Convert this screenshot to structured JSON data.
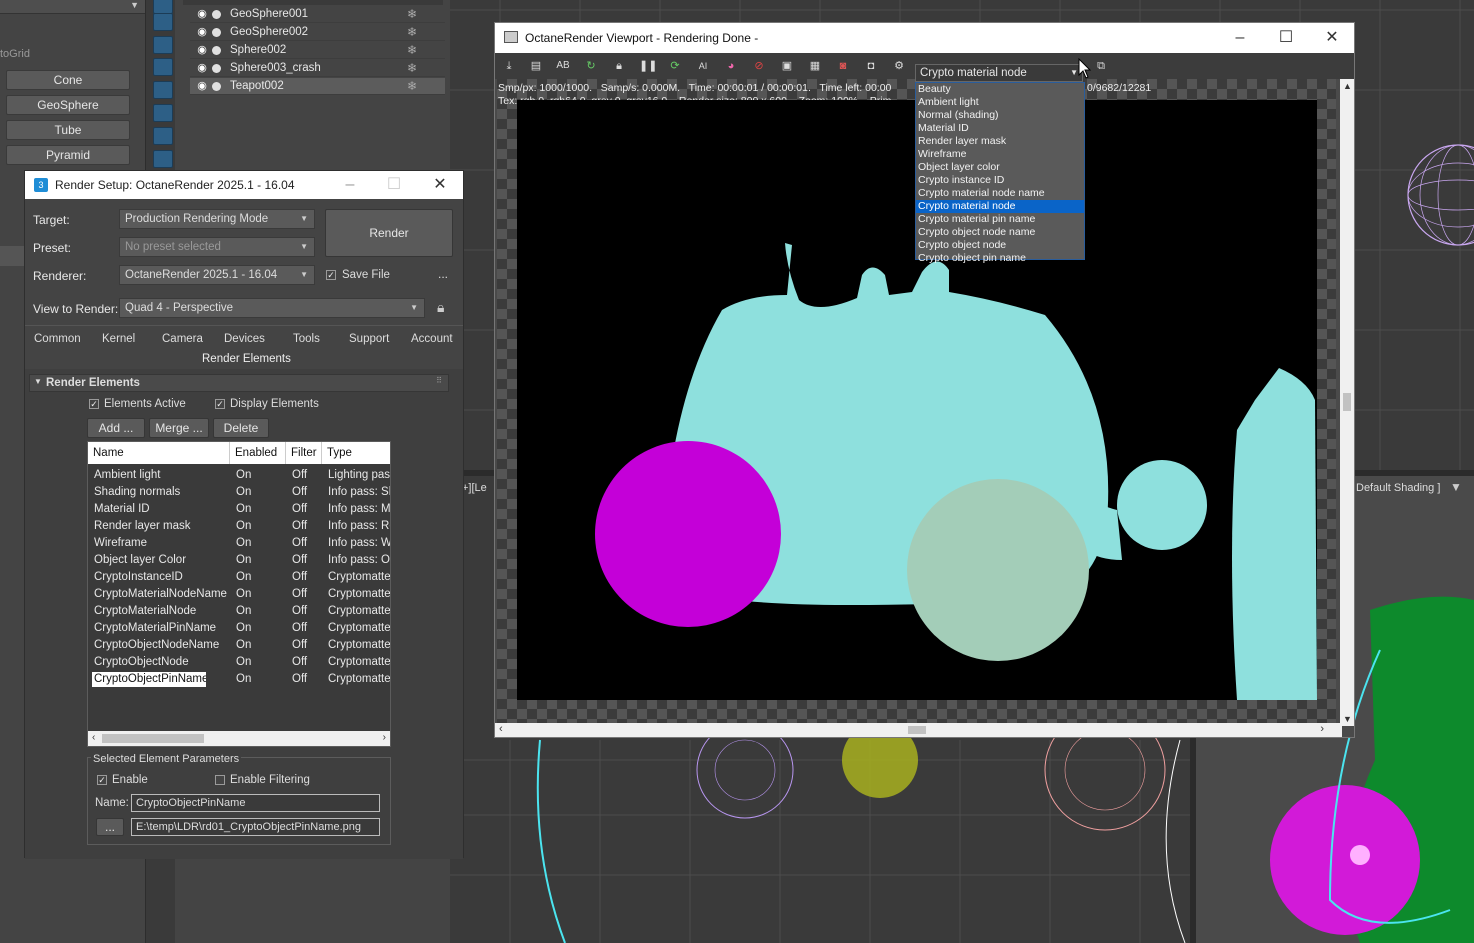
{
  "command_panel": {
    "top_label": "toGrid",
    "buttons": [
      "Cone",
      "GeoSphere",
      "Tube",
      "Pyramid"
    ]
  },
  "scene_explorer": {
    "rows": [
      "GeoSphere001",
      "GeoSphere002",
      "Sphere002",
      "Sphere003_crash",
      "Teapot002"
    ]
  },
  "render_setup": {
    "title": "Render Setup: OctaneRender 2025.1 - 16.04",
    "target_label": "Target:",
    "target_value": "Production Rendering Mode",
    "preset_label": "Preset:",
    "preset_value": "No preset selected",
    "renderer_label": "Renderer:",
    "renderer_value": "OctaneRender 2025.1 - 16.04",
    "save_file": "Save File",
    "more": "...",
    "render_button": "Render",
    "view_label": "View to Render:",
    "view_value": "Quad 4 - Perspective",
    "tabs": [
      "Common",
      "Kernel",
      "Camera",
      "Devices",
      "Tools",
      "Support",
      "Account"
    ],
    "subtab": "Render Elements",
    "rollout_title": "Render Elements",
    "elements_active": "Elements Active",
    "display_elements": "Display Elements",
    "add_button": "Add ...",
    "merge_button": "Merge ...",
    "delete_button": "Delete",
    "table_headers": [
      "Name",
      "Enabled",
      "Filter",
      "Type"
    ],
    "rows": [
      {
        "name": "Ambient light",
        "enabled": "On",
        "filter": "Off",
        "type": "Lighting pass"
      },
      {
        "name": "Shading normals",
        "enabled": "On",
        "filter": "Off",
        "type": "Info pass: Sh"
      },
      {
        "name": "Material ID",
        "enabled": "On",
        "filter": "Off",
        "type": "Info pass: Ma"
      },
      {
        "name": "Render layer mask",
        "enabled": "On",
        "filter": "Off",
        "type": "Info pass: Re"
      },
      {
        "name": "Wireframe",
        "enabled": "On",
        "filter": "Off",
        "type": "Info pass: W"
      },
      {
        "name": "Object layer Color",
        "enabled": "On",
        "filter": "Off",
        "type": "Info pass: Ol"
      },
      {
        "name": "CryptoInstanceID",
        "enabled": "On",
        "filter": "Off",
        "type": "Cryptomatte"
      },
      {
        "name": "CryptoMaterialNodeName",
        "enabled": "On",
        "filter": "Off",
        "type": "Cryptomatte"
      },
      {
        "name": "CryptoMaterialNode",
        "enabled": "On",
        "filter": "Off",
        "type": "Cryptomatte"
      },
      {
        "name": "CryptoMaterialPinName",
        "enabled": "On",
        "filter": "Off",
        "type": "Cryptomatte"
      },
      {
        "name": "CryptoObjectNodeName",
        "enabled": "On",
        "filter": "Off",
        "type": "Cryptomatte"
      },
      {
        "name": "CryptoObjectNode",
        "enabled": "On",
        "filter": "Off",
        "type": "Cryptomatte"
      },
      {
        "name": "CryptoObjectPinName",
        "enabled": "On",
        "filter": "Off",
        "type": "Cryptomatte"
      }
    ],
    "params_title": "Selected Element Parameters",
    "enable": "Enable",
    "enable_filtering": "Enable Filtering",
    "name_label": "Name:",
    "name_value": "CryptoObjectPinName",
    "path_button": "...",
    "path_value": "E:\\temp\\LDR\\rd01_CryptoObjectPinName.png"
  },
  "octane_viewport": {
    "title": "OctaneRender Viewport - Rendering Done -",
    "stats_line1": "Smp/px: 1000/1000.   Samp/s: 0.000M.   Time: 00:00:01 / 00:00:01.   Time left: 00:00",
    "stats_line2": "Tex: rgb 0, rgb64 0, grey 0, grey16 0.   Render size: 800 x 600.   Zoom: 100%.   Prim",
    "stats_right": "0/9682/12281",
    "dropdown_value": "Crypto material node",
    "dropdown_options": [
      "Beauty",
      "Ambient light",
      "Normal (shading)",
      "Material ID",
      "Render layer mask",
      "Wireframe",
      "Object layer color",
      "Crypto instance ID",
      "Crypto material node name",
      "Crypto material node",
      "Crypto material pin name",
      "Crypto object node name",
      "Crypto object node",
      "Crypto object pin name"
    ],
    "selected_option": "Crypto material node"
  },
  "viewport_labels": {
    "left_label": "+][Le",
    "shading_label": "Default Shading ]"
  },
  "colors": {
    "teapot": "#8ee0dd",
    "magenta_sphere": "#c400d8",
    "grey_sphere": "#a3cdb8",
    "selection": "#0a64c8"
  }
}
